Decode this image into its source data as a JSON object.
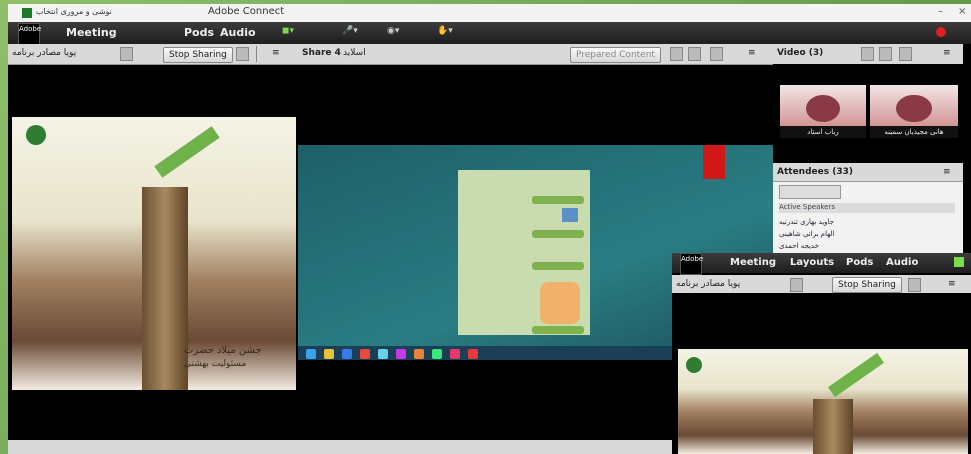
{
  "window": {
    "title": "Adobe Connect",
    "room_name": "نوشی و مروری انتخاب",
    "controls": {
      "minimize": "–",
      "close": "×"
    }
  },
  "menubar": {
    "logo_text": "Adobe",
    "items": [
      "Meeting",
      "Layouts",
      "Pods",
      "Audio"
    ],
    "visible_items": [
      "Meeting",
      "Pods",
      "Audio"
    ]
  },
  "share_pod": {
    "title": "Share 4",
    "subtitle": "اسلاید",
    "stop_sharing_label": "Stop Sharing",
    "prepared_label": "Prepared Content",
    "presenter_label": "پویا مصادر برنامه"
  },
  "video_pod": {
    "title": "Video (3)",
    "cams": [
      {
        "name": "رباب استاد"
      },
      {
        "name": "هانی مجیدیان سمینه"
      }
    ]
  },
  "attendees_pod": {
    "title": "Attendees (33)",
    "section": "Active Speakers",
    "rows": [
      "جاوید بهاری تندرنیه",
      "الهام براتی شاهینی",
      "خدیجه احمدی"
    ]
  },
  "overlay_window": {
    "menu": [
      "Meeting",
      "Layouts",
      "Pods",
      "Audio"
    ],
    "stop_sharing_label": "Stop Sharing",
    "presenter_label": "پویا مصادر برنامه"
  },
  "poster": {
    "caption_line1": "جشن میلاد حضرت",
    "caption_line2": "مسئولیت بهشتی"
  },
  "colors": {
    "accent_green": "#6fb24a",
    "record_red": "#e0201c",
    "chat_bubble": "#7fb24c"
  }
}
